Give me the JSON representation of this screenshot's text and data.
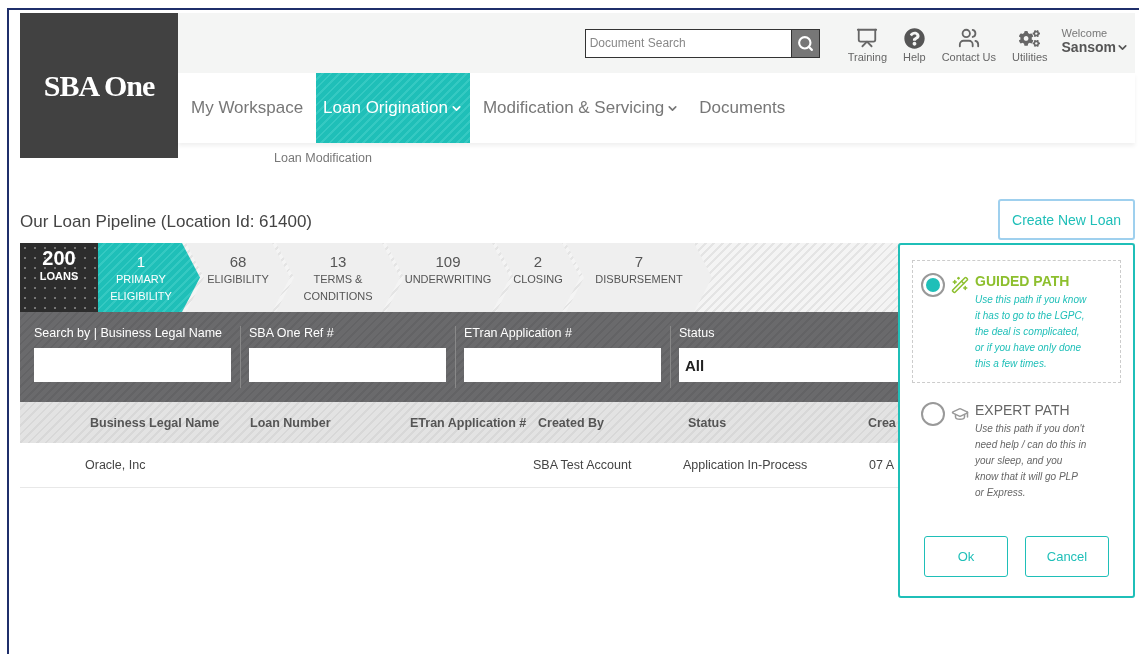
{
  "logo": {
    "text": "SBA One"
  },
  "search": {
    "placeholder": "Document Search"
  },
  "utilities": [
    {
      "kind": "training",
      "label": "Training"
    },
    {
      "kind": "help",
      "label": "Help"
    },
    {
      "kind": "contact",
      "label": "Contact Us"
    },
    {
      "kind": "utilities",
      "label": "Utilities"
    }
  ],
  "user": {
    "greeting": "Welcome",
    "name": "Sansom"
  },
  "nav": [
    {
      "label": "My Workspace",
      "selected": false,
      "has_menu": false
    },
    {
      "label": "Loan Origination",
      "selected": true,
      "has_menu": true
    },
    {
      "label": "Modification & Servicing",
      "selected": false,
      "has_menu": true
    },
    {
      "label": "Documents",
      "selected": false,
      "has_menu": false
    }
  ],
  "submenu": [
    "Loan Modification"
  ],
  "page_title": "Our Loan Pipeline (Location Id: 61400)",
  "create_button": "Create New Loan",
  "pipeline": {
    "total": {
      "count": "200",
      "label": "LOANS"
    },
    "stages": [
      {
        "count": "1",
        "label": "PRIMARY ELIGIBILITY",
        "selected": true
      },
      {
        "count": "68",
        "label": "ELIGIBILITY",
        "selected": false
      },
      {
        "count": "13",
        "label": "TERMS & CONDITIONS",
        "selected": false
      },
      {
        "count": "109",
        "label": "UNDERWRITING",
        "selected": false
      },
      {
        "count": "2",
        "label": "CLOSING",
        "selected": false
      },
      {
        "count": "7",
        "label": "DISBURSEMENT",
        "selected": false
      }
    ]
  },
  "filters": [
    {
      "kind": "text",
      "label": "Search by | Business Legal Name"
    },
    {
      "kind": "text",
      "label": "SBA One Ref #"
    },
    {
      "kind": "text",
      "label": "ETran Application #"
    },
    {
      "kind": "select",
      "label": "Status",
      "value": "All"
    }
  ],
  "table": {
    "columns": [
      "Business Legal Name",
      "Loan Number",
      "ETran Application #",
      "Created By",
      "Status",
      "Crea"
    ],
    "rows": [
      {
        "cells": [
          "Oracle, Inc",
          null,
          null,
          "SBA Test Account",
          "Application In-Process",
          "07 A"
        ]
      }
    ]
  },
  "path_dialog": {
    "options": [
      {
        "kind": "guided",
        "title": "GUIDED PATH",
        "description": "Use this path if you know it has to go to the LGPC, the deal is complicated, or if you have only done this a few times.",
        "selected": true
      },
      {
        "kind": "expert",
        "title": "EXPERT PATH",
        "description": "Use this path if you don't need help / can do this in your sleep, and you know that it will go PLP or Express.",
        "selected": false
      }
    ],
    "buttons": [
      "Ok",
      "Cancel"
    ]
  }
}
